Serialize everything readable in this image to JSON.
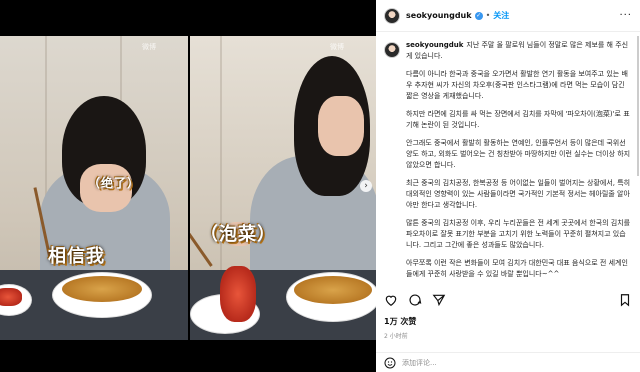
{
  "media": {
    "watermark_left": "微博",
    "watermark_right": "微博",
    "caption_left_top": "（绝了）",
    "caption_left_bottom": "相信我",
    "caption_right": "（泡菜）"
  },
  "post": {
    "username": "seokyoungduk",
    "separator": "•",
    "follow_label": "关注",
    "more_label": "···",
    "caption_username": "seokyoungduk",
    "paragraphs": [
      "지난 주말 올 팔로워 님들이 정말로 많은 제보를 해 주신게 있습니다.",
      "다름이 아니라 한국과 중국을 오가면서 활발한 연기 활동을 보여주고 있는 배우 추자현 씨가 자신의 차오후(중국판 인스타그램)에 라면 먹는 모습이 담긴 짧은 영상을 게재했습니다.",
      "하지만 라면에 김치를 싸 먹는 장면에서 김치를 자막에 '파오차이(泡菜)'로 표기해 논란이 된 것입니다.",
      "안그래도 중국에서 활발히 활동하는 연예인, 인플루언서 등이 많은데 국위선양도 하고, 외화도 벌어오는 건 칭찬받아 마땅하지만 이런 실수는 더이상 하지 않았으면 합니다.",
      "최근 중국의 김치공정, 한복공정 등 어이없는 일들이 벌어지는 상황에서, 특히 대외적인 영향력이 있는 사람들이라면 국가적인 기본적 정서는 헤아릴줄 알아야만 한다고 생각합니다.",
      "많튼 중국의 김치공정 이후, 우리 누리꾼들은 전 세계 곳곳에서 한국의 김치를 파오차이로 잘못 표기한 부분을 고치기 위한 노력들이 꾸준히 펼쳐지고 있습니다. 그리고 그간에 좋은 성과들도 많았습니다.",
      "아무쪼록 이런 작은 변화들이 모여 김치가 대한민국 대표 음식으로 전 세계인들에게 꾸준히 사랑받을 수 있길 바랄 뿐입니다~^^"
    ],
    "likes": "1万 次赞",
    "time": "2 小时前",
    "comment_placeholder": "添加评论..."
  },
  "colors": {
    "accent": "#0095f6",
    "verified": "#3897f0",
    "muted": "#8e8e8e"
  },
  "icons": [
    "heart-icon",
    "comment-icon",
    "share-icon",
    "bookmark-icon",
    "emoji-icon",
    "more-icon",
    "verified-icon"
  ]
}
